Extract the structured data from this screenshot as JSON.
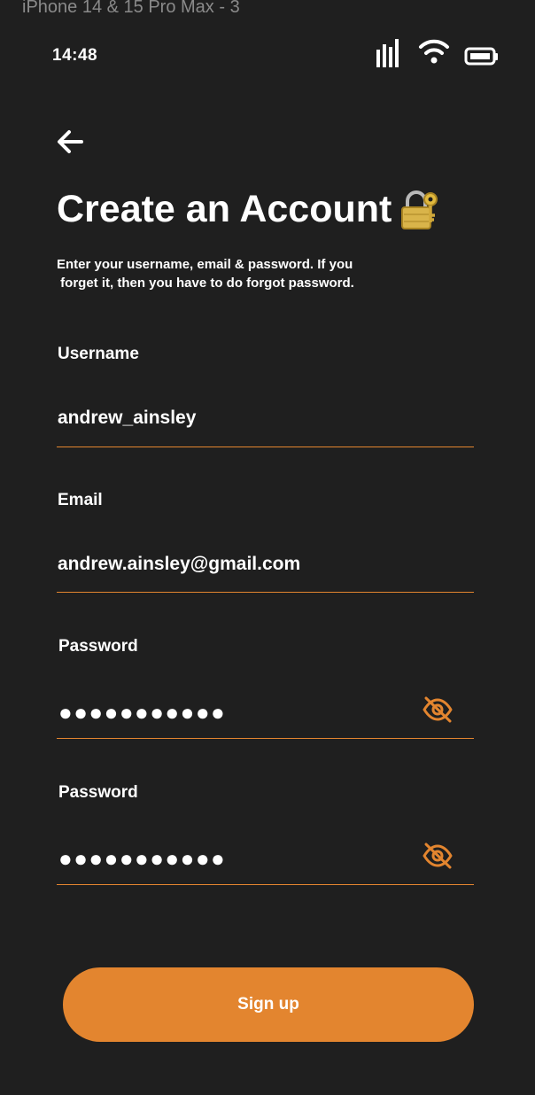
{
  "frame_label": "iPhone 14 & 15 Pro Max - 3",
  "status_bar": {
    "time": "14:48"
  },
  "header": {
    "title": "Create an Account",
    "subtitle_line1": "Enter your username, email & password. If you",
    "subtitle_line2": " forget it, then you have to do forgot password."
  },
  "form": {
    "username": {
      "label": "Username",
      "value": "andrew_ainsley"
    },
    "email": {
      "label": "Email",
      "value": "andrew.ainsley@gmail.com"
    },
    "password": {
      "label": "Password",
      "masked": "●●●●●●●●●●●"
    },
    "confirm_password": {
      "label": "Password",
      "masked": "●●●●●●●●●●●"
    }
  },
  "actions": {
    "signup_label": "Sign up"
  },
  "colors": {
    "background": "#1f1f1f",
    "accent": "#e3852f",
    "text": "#ffffff"
  },
  "icons": [
    "back-arrow-icon",
    "lock-with-key-icon",
    "eye-slash-icon",
    "signal-icon",
    "wifi-icon",
    "battery-icon"
  ]
}
